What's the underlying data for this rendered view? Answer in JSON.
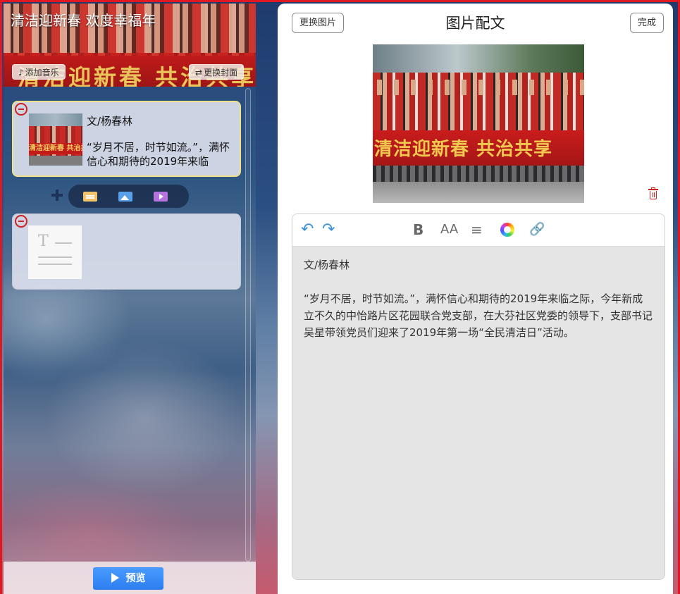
{
  "left_panel": {
    "cover": {
      "title": "清洁迎新春 欢度幸福年",
      "banner_text": "清洁迎新春 共治共享",
      "add_music_label": "添加音乐",
      "change_cover_label": "更换封面"
    },
    "cards": [
      {
        "type": "image-text",
        "author": "文/杨春林",
        "excerpt": "“岁月不居，时节如流。”，满怀信心和期待的2019年来临",
        "thumb_banner": "清洁迎新春 共治共享"
      },
      {
        "type": "text"
      }
    ],
    "preview_label": "预览"
  },
  "editor_panel": {
    "title": "图片配文",
    "change_image_label": "更换图片",
    "done_label": "完成",
    "photo_banner_text": "清洁迎新春 共治共享",
    "content": {
      "author": "文/杨春林",
      "body": "“岁月不居，时节如流。”，满怀信心和期待的2019年来临之际，今年新成立不久的中怡路片区花园联合党支部，在大芬社区党委的领导下，支部书记吴星带领党员们迎来了2019年第一场“全民清洁日”活动。"
    },
    "toolbar": {
      "undo_icon": "undo-icon",
      "redo_icon": "redo-icon",
      "bold_label": "B",
      "font_size_label": "AA"
    }
  },
  "colors": {
    "accent_red": "#e01822",
    "primary_blue": "#2c7ef0",
    "toolbar_blue": "#3b8fd9"
  }
}
